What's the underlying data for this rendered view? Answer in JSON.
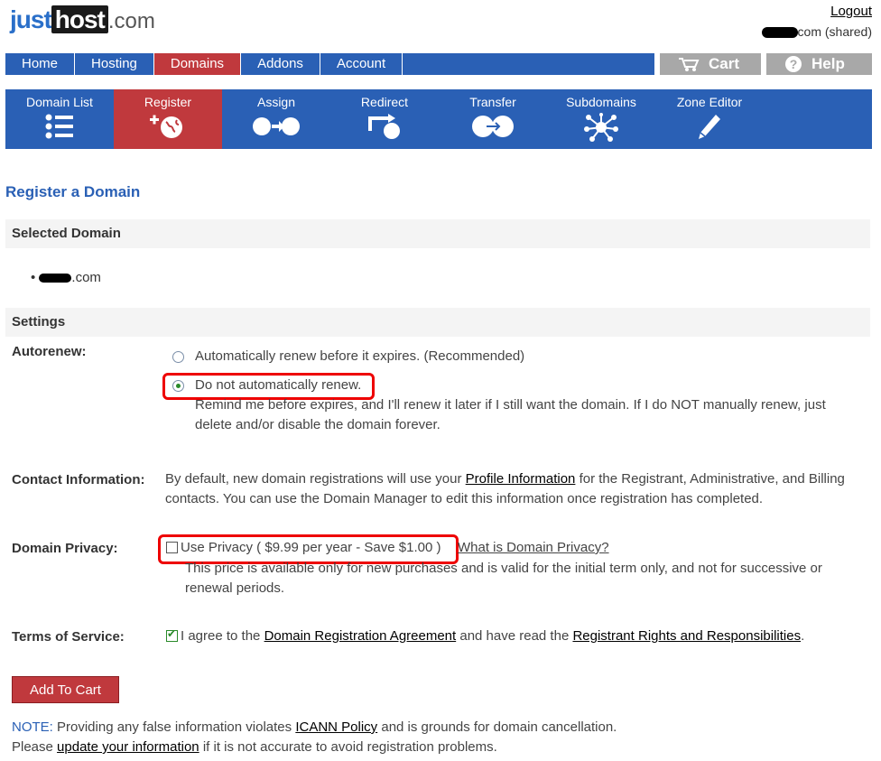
{
  "brand": {
    "just": "just",
    "host": "host",
    "com": ".com"
  },
  "header": {
    "logout": "Logout",
    "account_suffix": "com (shared)"
  },
  "topnav": {
    "items": [
      "Home",
      "Hosting",
      "Domains",
      "Addons",
      "Account"
    ],
    "active": "Domains"
  },
  "topnav_right": {
    "cart": "Cart",
    "help": "Help"
  },
  "subnav": {
    "tabs": [
      "Domain List",
      "Register",
      "Assign",
      "Redirect",
      "Transfer",
      "Subdomains",
      "Zone Editor"
    ],
    "active": "Register"
  },
  "page": {
    "title": "Register a Domain"
  },
  "selected_domain": {
    "heading": "Selected Domain",
    "domain_suffix": ".com"
  },
  "settings": {
    "heading": "Settings",
    "autorenew_label": "Autorenew:",
    "option_auto": "Automatically renew before it expires. (Recommended)",
    "option_manual": "Do not automatically renew.",
    "manual_desc_1": "Remind me before expires, and I'll renew it later if I still want the domain. If I do NOT manually renew, just",
    "manual_desc_2": "delete and/or disable the domain forever.",
    "contact_label": "Contact Information:",
    "contact_pre": "By default, new domain registrations will use your ",
    "contact_link": "Profile Information",
    "contact_post": " for the Registrant, Administrative, and Billing",
    "contact_line2": "contacts. You can use the Domain Manager to edit this information once registration has completed.",
    "privacy_label": "Domain Privacy:",
    "privacy_option": "Use Privacy ( $9.99 per year - Save $1.00 )",
    "privacy_link": "What is Domain Privacy?",
    "privacy_desc_1": "This price is available only for new purchases and is valid for the initial term only, and not for successive or",
    "privacy_desc_2": "renewal periods.",
    "tos_label": "Terms of Service:",
    "tos_pre": "I agree to the ",
    "tos_link1": "Domain Registration Agreement",
    "tos_mid": " and have read the ",
    "tos_link2": "Registrant Rights and Responsibilities",
    "tos_post": "."
  },
  "actions": {
    "add_to_cart": "Add To Cart"
  },
  "footer": {
    "note_label": "NOTE:",
    "note_pre": " Providing any false information violates ",
    "note_link": "ICANN Policy",
    "note_post": " and is grounds for domain cancellation.",
    "line2_pre": "Please ",
    "line2_link": "update your information",
    "line2_post": " if it is not accurate to avoid registration problems."
  },
  "state": {
    "autorenew": "manual",
    "privacy_checked": false,
    "tos_checked": true
  },
  "colors": {
    "nav_blue": "#2a60b5",
    "nav_red": "#c0393d",
    "highlight": "#ee0000"
  }
}
